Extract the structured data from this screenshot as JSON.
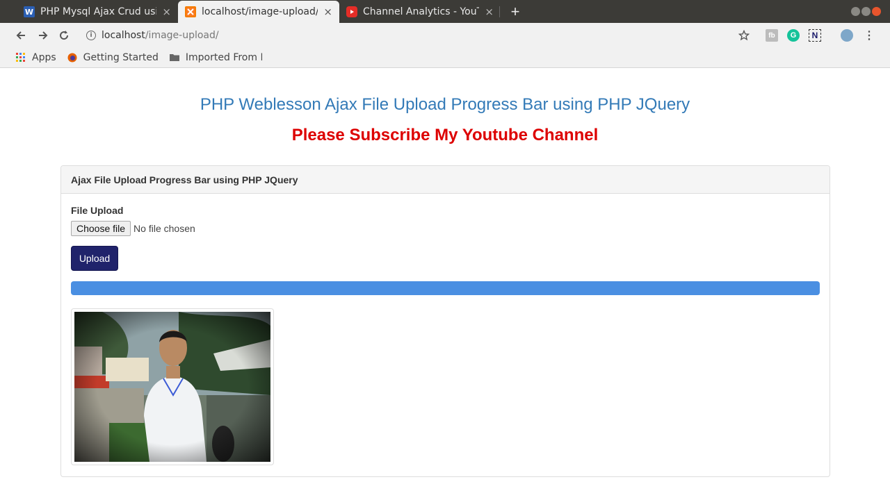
{
  "browser": {
    "tabs": [
      {
        "title": "PHP Mysql Ajax Crud usin",
        "close": "×",
        "favicon_letter": "W"
      },
      {
        "title": "localhost/image-upload/",
        "close": "×"
      },
      {
        "title": "Channel Analytics - YouTu",
        "close": "×"
      }
    ],
    "new_tab": "+",
    "url_host": "localhost",
    "url_path": "/image-upload/",
    "bookmarks": [
      {
        "label": "Apps"
      },
      {
        "label": "Getting Started"
      },
      {
        "label": "Imported From F"
      }
    ]
  },
  "page": {
    "title": "PHP Weblesson Ajax File Upload Progress Bar using PHP JQuery",
    "subtitle": "Please Subscribe My Youtube Channel",
    "panel_heading": "Ajax File Upload Progress Bar using PHP JQuery",
    "file_label": "File Upload",
    "choose_button": "Choose file",
    "no_file_text": "No file chosen",
    "upload_button": "Upload",
    "progress_percent": 100
  },
  "colors": {
    "title": "#337ab7",
    "subtitle": "#dd0000",
    "upload_button": "#20236b",
    "progress": "#4a8fe2"
  }
}
